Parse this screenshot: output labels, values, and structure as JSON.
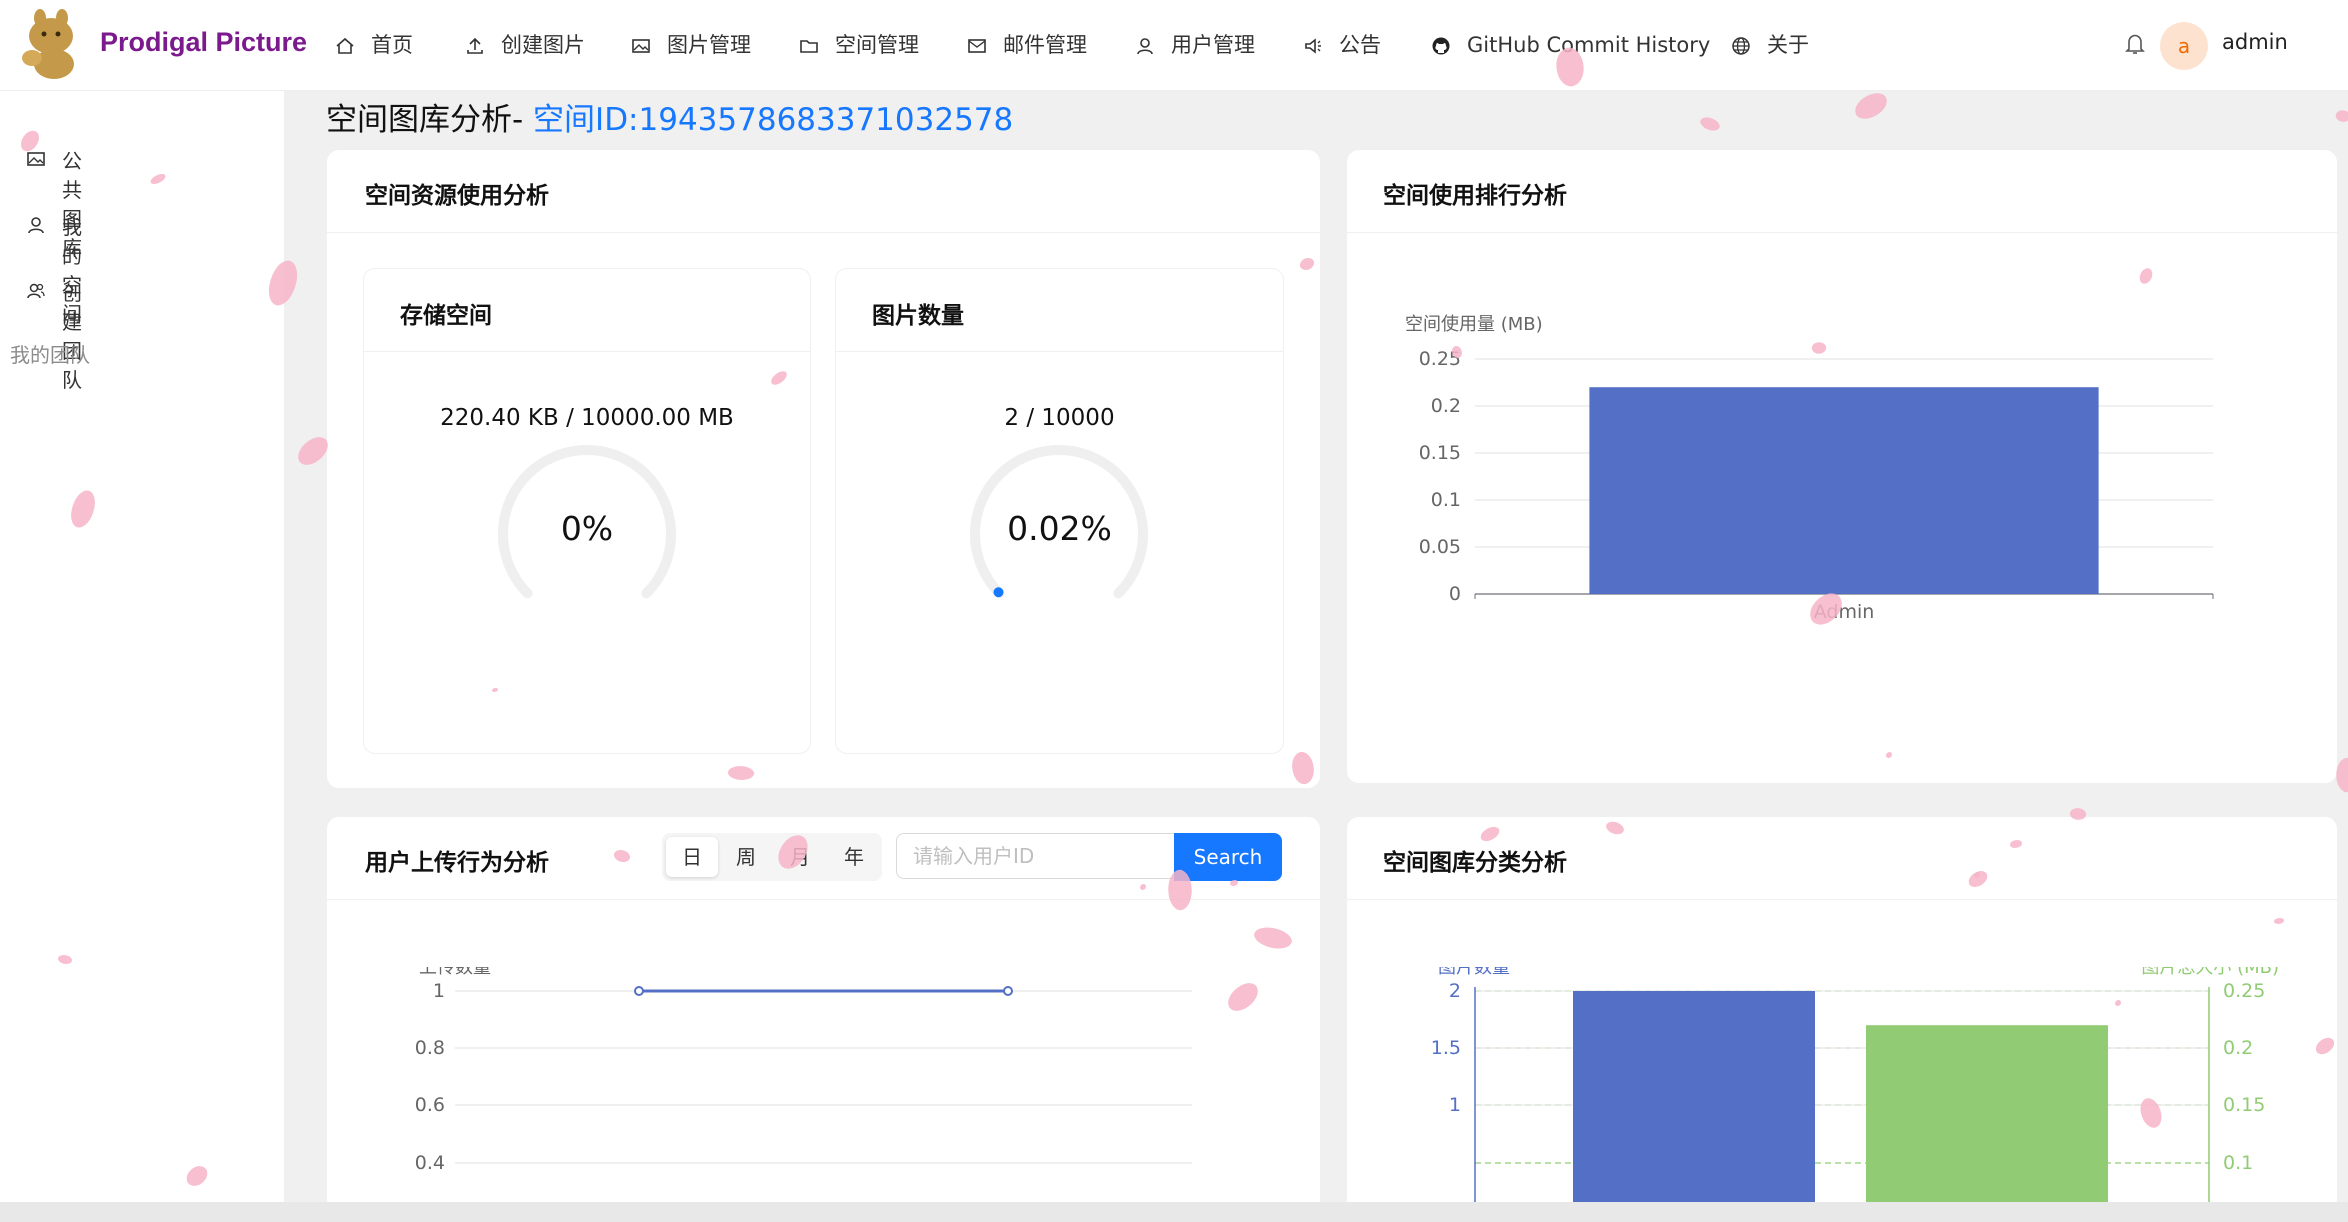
{
  "app": {
    "brand": "Prodigal Picture"
  },
  "nav": {
    "items": [
      {
        "label": "首页",
        "icon": "home-icon"
      },
      {
        "label": "创建图片",
        "icon": "upload-icon"
      },
      {
        "label": "图片管理",
        "icon": "picture-icon"
      },
      {
        "label": "空间管理",
        "icon": "folder-icon"
      },
      {
        "label": "邮件管理",
        "icon": "mail-icon"
      },
      {
        "label": "用户管理",
        "icon": "user-icon"
      },
      {
        "label": "公告",
        "icon": "sound-icon"
      },
      {
        "label": "GitHub Commit History",
        "icon": "github-icon"
      },
      {
        "label": "关于",
        "icon": "globe-icon"
      }
    ],
    "user": {
      "avatar_letter": "a",
      "name": "admin"
    }
  },
  "sidebar": {
    "items": [
      {
        "label": "公共图库",
        "icon": "picture-icon"
      },
      {
        "label": "我的空间",
        "icon": "user-icon"
      },
      {
        "label": "创建团队",
        "icon": "team-icon"
      }
    ],
    "group_label": "我的团队"
  },
  "page": {
    "title_prefix": "空间图库分析- ",
    "space_id": "空间ID:1943578683371032578"
  },
  "resource_card": {
    "title": "空间资源使用分析",
    "storage": {
      "title": "存储空间",
      "usage": "220.40 KB / 10000.00 MB",
      "percent_label": "0%",
      "percent": 0
    },
    "count": {
      "title": "图片数量",
      "usage": "2 / 10000",
      "percent_label": "0.02%",
      "percent": 0.02
    }
  },
  "rank_card": {
    "title": "空间使用排行分析",
    "chart_data": {
      "type": "bar",
      "ylabel": "空间使用量 (MB)",
      "categories": [
        "Admin"
      ],
      "values": [
        0.22
      ],
      "ylim": [
        0,
        0.25
      ],
      "yticks": [
        "0",
        "0.05",
        "0.1",
        "0.15",
        "0.2",
        "0.25"
      ],
      "color": "#5470c6"
    }
  },
  "upload_card": {
    "title": "用户上传行为分析",
    "segments": [
      "日",
      "周",
      "月",
      "年"
    ],
    "active_segment": "日",
    "search_placeholder": "请输入用户ID",
    "search_label": "Search",
    "chart_data": {
      "type": "line",
      "ylabel": "上传数量",
      "values": [
        1,
        1
      ],
      "yticks": [
        "1",
        "0.8",
        "0.6",
        "0.4"
      ],
      "color": "#5470c6"
    }
  },
  "category_card": {
    "title": "空间图库分类分析",
    "chart_data": {
      "type": "bar",
      "series": [
        {
          "name": "图片数量",
          "values": [
            2
          ],
          "color": "#5470c6"
        },
        {
          "name": "图片总大小 (MB)",
          "values": [
            0.22
          ],
          "color": "#91cc75"
        }
      ],
      "y_left_ticks": [
        "2",
        "1.5",
        "1"
      ],
      "y_right_ticks": [
        "0.25",
        "0.2",
        "0.15",
        "0.1"
      ]
    }
  }
}
